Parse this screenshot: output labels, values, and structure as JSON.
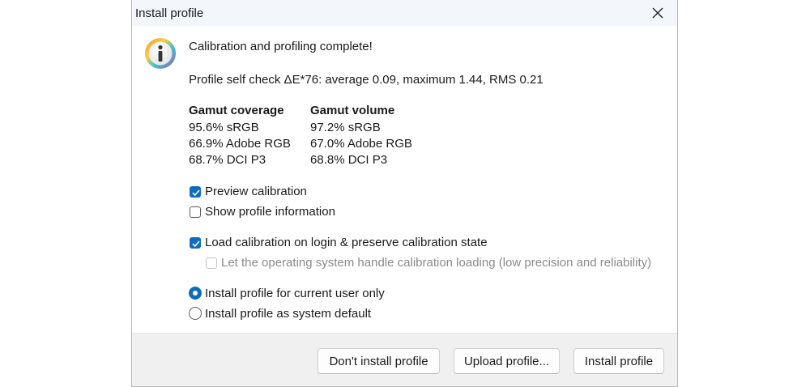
{
  "window": {
    "title": "Install profile"
  },
  "message": {
    "headline": "Calibration and profiling complete!",
    "self_check": "Profile self check ΔE*76: average 0.09, maximum 1.44, RMS 0.21"
  },
  "gamut": {
    "coverage": {
      "header": "Gamut coverage",
      "rows": [
        "95.6% sRGB",
        "66.9% Adobe RGB",
        "68.7% DCI P3"
      ]
    },
    "volume": {
      "header": "Gamut volume",
      "rows": [
        "97.2% sRGB",
        "67.0% Adobe RGB",
        "68.8% DCI P3"
      ]
    }
  },
  "options": {
    "preview_calibration": {
      "label": "Preview calibration",
      "checked": true
    },
    "show_profile_information": {
      "label": "Show profile information",
      "checked": false
    },
    "load_calibration": {
      "label": "Load calibration on login & preserve calibration state",
      "checked": true
    },
    "os_handle_loading": {
      "label": "Let the operating system handle calibration loading (low precision and reliability)",
      "checked": false,
      "enabled": false
    }
  },
  "install_scope": {
    "current_user": {
      "label": "Install profile for current user only",
      "selected": true
    },
    "system_default": {
      "label": "Install profile as system default",
      "selected": false
    }
  },
  "buttons": {
    "dont_install": "Don't install profile",
    "upload": "Upload profile...",
    "install": "Install profile"
  },
  "colors": {
    "accent": "#0f6cbd",
    "footer_bg": "#f0f0f0",
    "titlebar_bg": "#f3f6fb"
  }
}
